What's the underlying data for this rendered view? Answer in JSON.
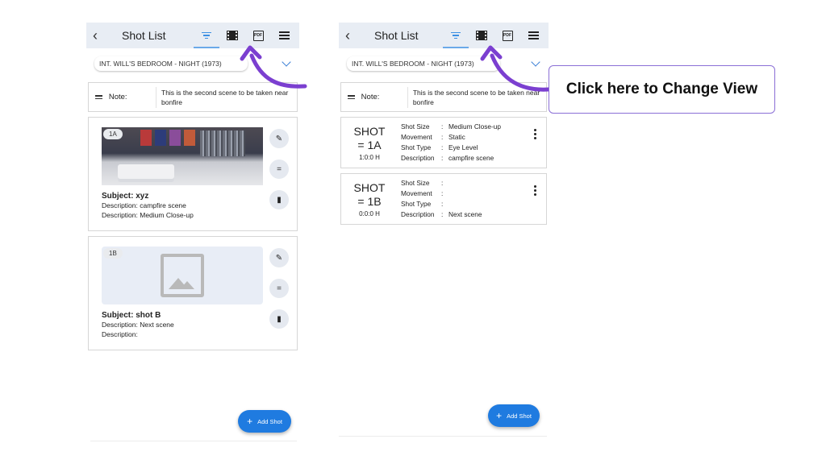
{
  "app": {
    "title": "Shot List",
    "scene": "INT.  WILL'S BEDROOM - NIGHT (1973)",
    "note_label": "Note:",
    "note_text": "This is the second scene to be taken near bonfire",
    "add_shot": "Add Shot"
  },
  "icons": {
    "back": "back-arrow-icon",
    "filter": "filter-icon",
    "storyboard": "film-reel-icon",
    "pdf": "pdf-icon",
    "menu": "hamburger-menu-icon"
  },
  "grid_view": {
    "cards": [
      {
        "tag": "1A",
        "subject": "Subject: xyz",
        "desc1": "Description: campfire scene",
        "desc2": "Description: Medium Close-up"
      },
      {
        "tag": "1B",
        "subject": "Subject: shot B",
        "desc1": "Description: Next scene",
        "desc2": "Description:"
      }
    ]
  },
  "list_view": {
    "shot_word": "SHOT",
    "labels": {
      "size": "Shot Size",
      "movement": "Movement",
      "type": "Shot Type",
      "description": "Description"
    },
    "rows": [
      {
        "id": "1A",
        "time": "1:0:0 H",
        "size": "Medium Close-up",
        "movement": "Static",
        "type": "Eye Level",
        "description": "campfire scene"
      },
      {
        "id": "1B",
        "time": "0:0:0 H",
        "size": "",
        "movement": "",
        "type": "",
        "description": "Next scene"
      }
    ]
  },
  "callout": "Click here to  Change View",
  "colors": {
    "appbar": "#e8edf4",
    "accent": "#1f7be0",
    "arrow": "#7b3fd0",
    "callout_border": "#8b6fd6"
  }
}
